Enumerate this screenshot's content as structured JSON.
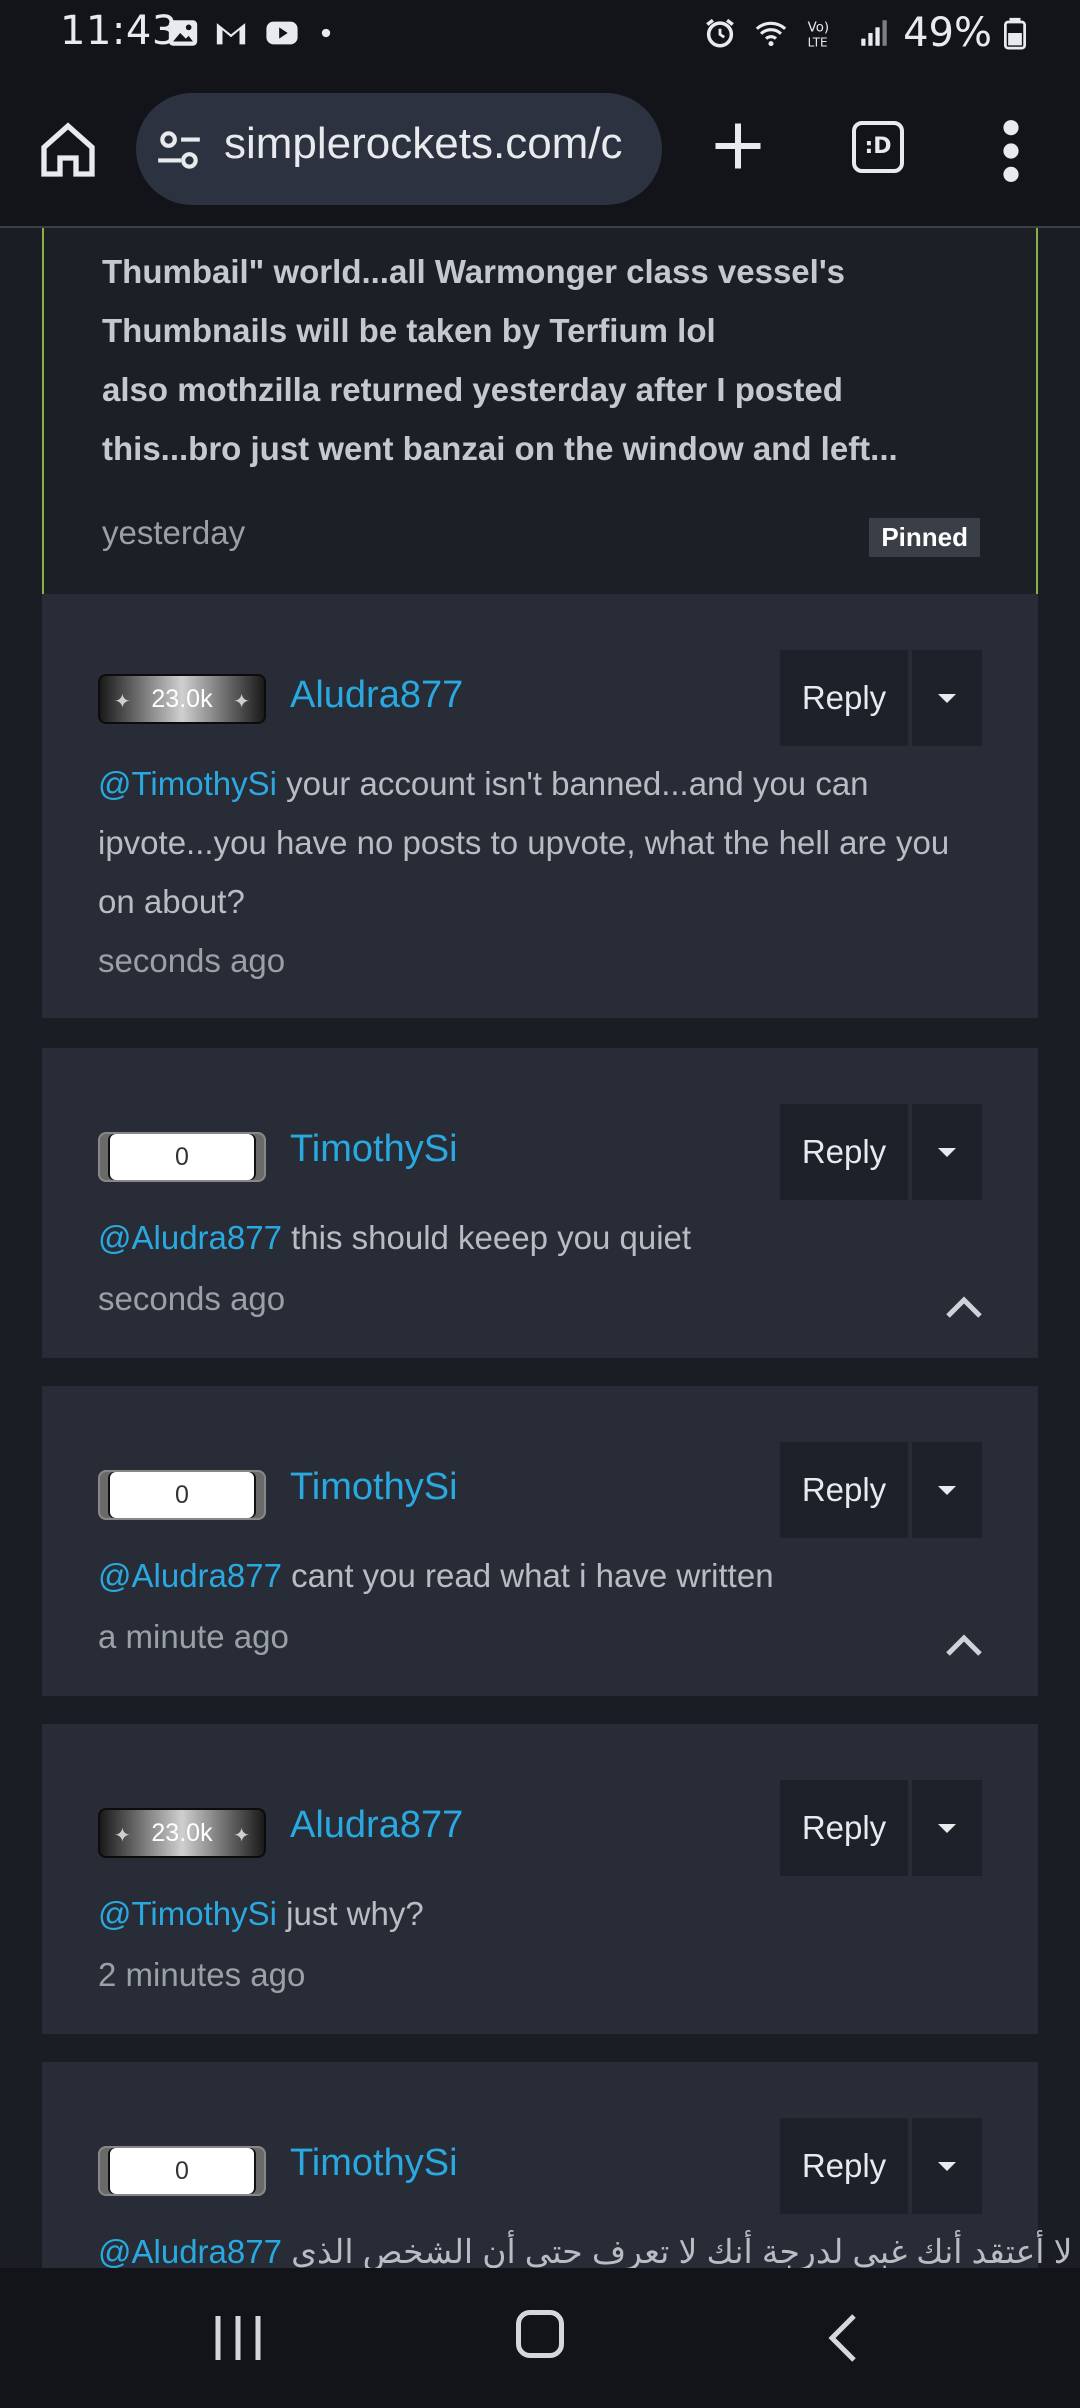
{
  "status_bar": {
    "time": "11:43",
    "battery": "49%",
    "icons": [
      "gallery-icon",
      "gmail-icon",
      "youtube-icon",
      "dot-icon",
      "alarm-icon",
      "wifi-icon",
      "volte-icon",
      "signal-icon",
      "battery-icon"
    ]
  },
  "browser": {
    "url": "simplerockets.com/c",
    "tabs_count": ":D"
  },
  "pinned": {
    "lines": [
      "Thumbail\" world...all Warmonger class vessel's",
      "Thumbnails will be taken by Terfium lol",
      "also mothzilla returned yesterday after I posted",
      "this...bro just went banzai on the window and left..."
    ],
    "time": "yesterday",
    "badge": "Pinned"
  },
  "comments": [
    {
      "points": "23.0k",
      "username": "Aludra877",
      "reply": "Reply",
      "mention": "@TimothySi",
      "text": " your account isn't banned...and you can ipvote...you have no posts to upvote, what the hell are you on about?",
      "time": "seconds ago"
    },
    {
      "points": "0",
      "username": "TimothySi",
      "reply": "Reply",
      "mention": "@Aludra877",
      "text": " this should keeep you quiet",
      "time": "seconds ago"
    },
    {
      "points": "0",
      "username": "TimothySi",
      "reply": "Reply",
      "mention": "@Aludra877",
      "text": " cant you read what i have written",
      "time": "a minute ago"
    },
    {
      "points": "23.0k",
      "username": "Aludra877",
      "reply": "Reply",
      "mention": "@TimothySi",
      "text": " just why?",
      "time": "2 minutes ago"
    },
    {
      "points": "0",
      "username": "TimothySi",
      "reply": "Reply",
      "mention": "@Aludra877",
      "text": " لا أعتقد أنك غبي لدرجة أنك لا تعرف حتى أن الشخص الذي"
    }
  ]
}
